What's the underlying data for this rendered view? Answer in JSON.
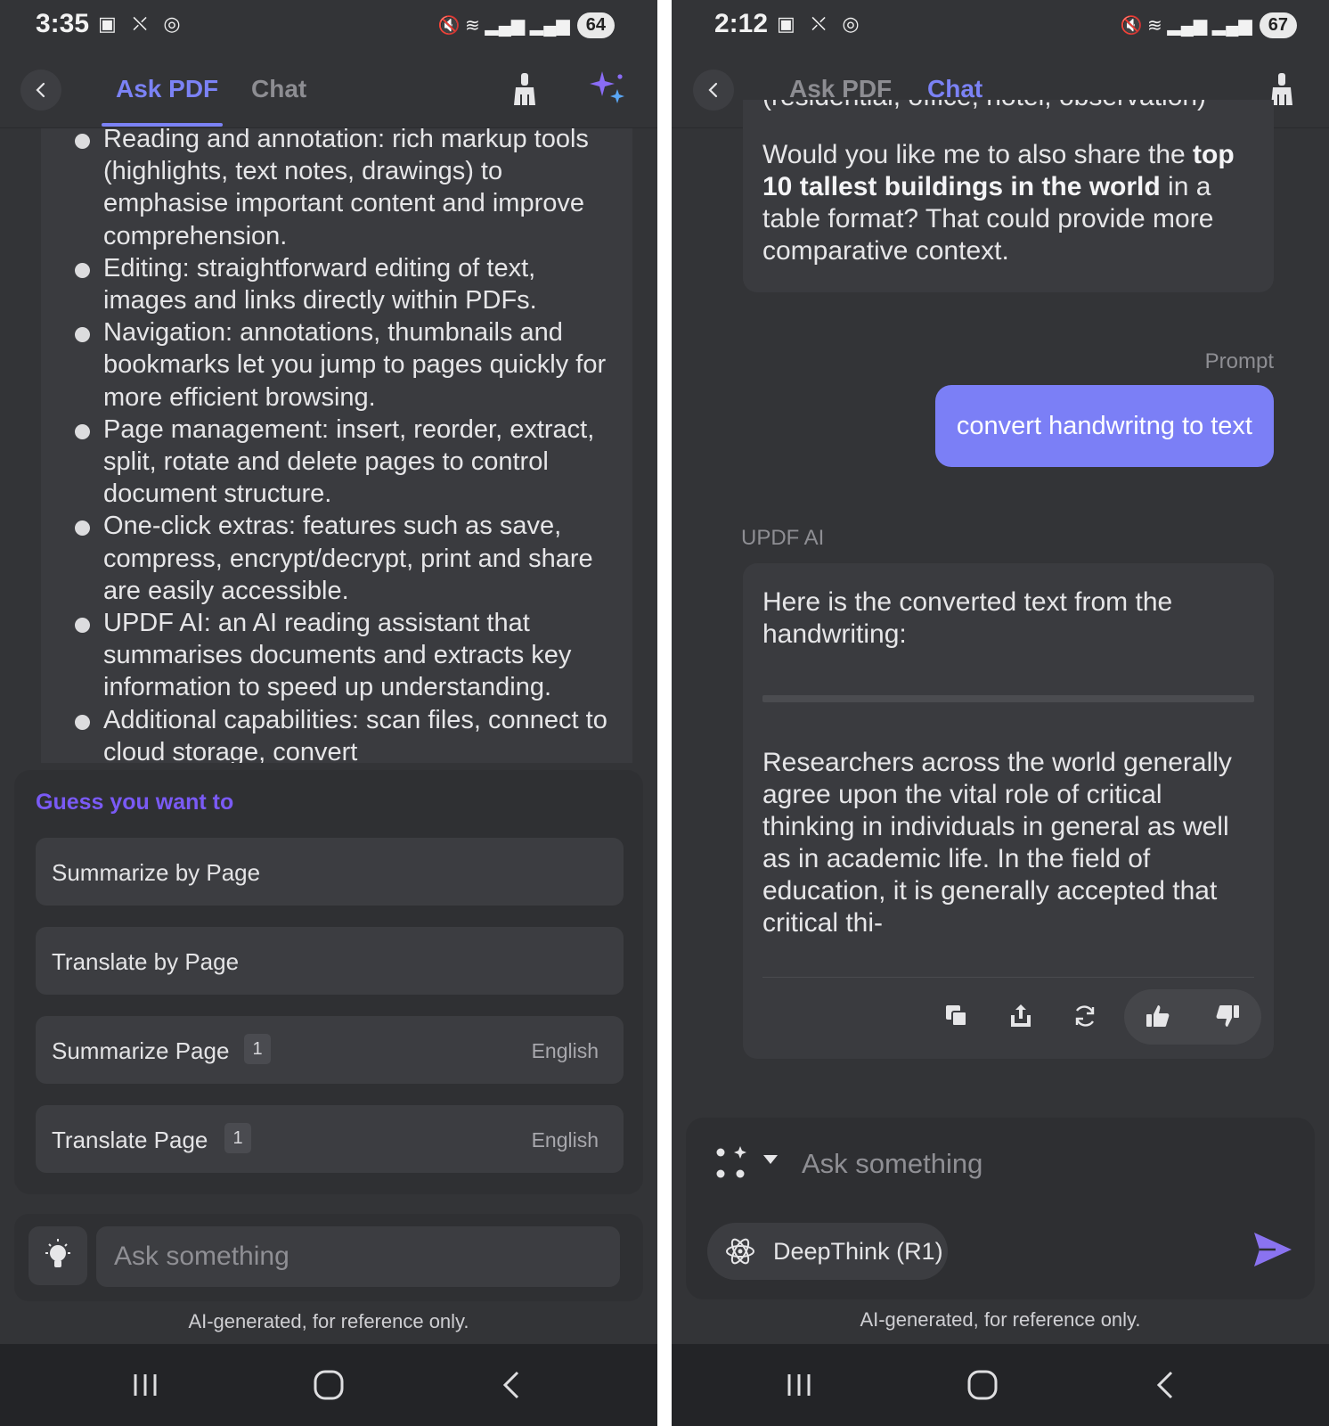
{
  "left": {
    "status": {
      "time": "3:35",
      "left_icons": "▣ ⛌ ◎",
      "signal": "🔇 ≋ ▂▄▆ ▂▄▆",
      "battery": "64"
    },
    "tabs": [
      {
        "label": "Ask PDF",
        "active": true
      },
      {
        "label": "Chat",
        "active": false
      }
    ],
    "bullets": [
      "Reading and annotation: rich markup tools (highlights, text notes, drawings) to emphasise important content and improve comprehension.",
      "Editing: straightforward editing of text, images and links directly within PDFs.",
      "Navigation: annotations, thumbnails and bookmarks let you jump to pages quickly for more efficient browsing.",
      "Page management: insert, reorder, extract, split, rotate and delete pages to control document structure.",
      "One-click extras: features such as save, compress, encrypt/decrypt, print and share are easily accessible.",
      "UPDF AI: an AI reading assistant that summarises documents and extracts key information to speed up understanding.",
      "Additional capabilities: scan files, connect to cloud storage, convert"
    ],
    "suggest": {
      "title": "Guess you want to",
      "items": [
        {
          "label": "Summarize by Page"
        },
        {
          "label": "Translate by Page"
        },
        {
          "label": "Summarize Page",
          "page": "1",
          "lang": "English"
        },
        {
          "label": "Translate Page",
          "page": "1",
          "lang": "English"
        }
      ]
    },
    "input": {
      "placeholder": "Ask something"
    },
    "disclaimer": "AI-generated, for reference only."
  },
  "right": {
    "status": {
      "time": "2:12",
      "left_icons": "▣ ⛌ ◎",
      "signal": "🔇 ≋ ▂▄▆ ▂▄▆",
      "battery": "67"
    },
    "tabs": [
      {
        "label": "Ask PDF",
        "active": false
      },
      {
        "label": "Chat",
        "active": true
      }
    ],
    "prev_message": {
      "cut_line": "(residential, office, hotel, observation)",
      "pre": "Would you like me to also share the ",
      "bold": "top 10 tallest buildings in the world",
      "post": " in a table format? That could provide more comparative context."
    },
    "prompt_label": "Prompt",
    "user_message": "convert handwritng to text",
    "ai_label": "UPDF AI",
    "ai_intro": "Here is the converted text from the handwriting:",
    "ai_body": "Researchers across the world generally agree upon the vital role of critical thinking in individuals in general as well as in academic life. In the field of education, it is generally accepted that critical thi-",
    "composer": {
      "placeholder": "Ask something",
      "model": "DeepThink (R1)"
    },
    "disclaimer": "AI-generated, for reference only."
  },
  "colors": {
    "accent": "#7b82f5",
    "bubble": "#7b7ff6",
    "suggest_title": "#7a5af5",
    "bg": "#333437"
  },
  "icons": [
    "chevron-left-icon",
    "broom-icon",
    "sparkle-icon",
    "lightbulb-icon",
    "copy-icon",
    "share-icon",
    "refresh-icon",
    "thumbs-up-icon",
    "thumbs-down-icon",
    "dots-grid-icon",
    "atom-icon",
    "send-icon",
    "recents-icon",
    "home-icon",
    "back-nav-icon"
  ]
}
